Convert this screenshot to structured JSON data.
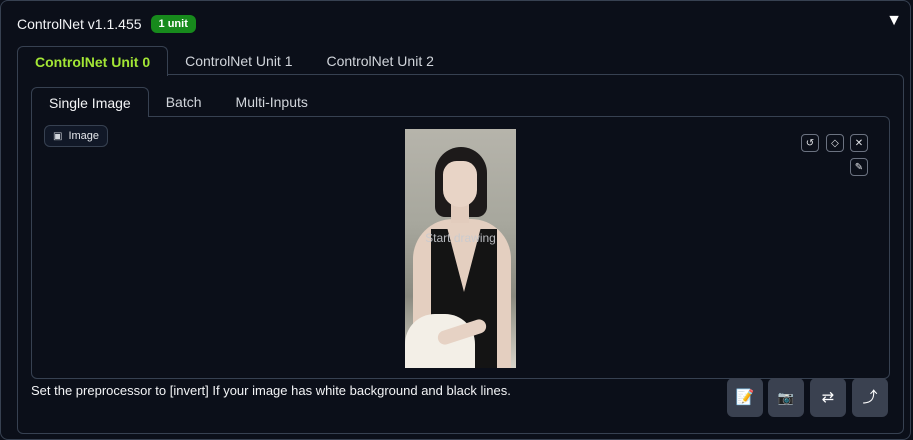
{
  "header": {
    "title": "ControlNet v1.1.455",
    "badge": "1 unit",
    "collapse_glyph": "▼"
  },
  "unit_tabs": [
    {
      "label": "ControlNet Unit 0",
      "active": true
    },
    {
      "label": "ControlNet Unit 1",
      "active": false
    },
    {
      "label": "ControlNet Unit 2",
      "active": false
    }
  ],
  "input_tabs": [
    {
      "label": "Single Image",
      "active": true
    },
    {
      "label": "Batch",
      "active": false
    },
    {
      "label": "Multi-Inputs",
      "active": false
    }
  ],
  "image_panel": {
    "label": "Image",
    "overlay_text": "Start drawing",
    "tools": [
      "undo-icon",
      "eraser-icon",
      "close-icon",
      "brush-icon"
    ]
  },
  "hint": "Set the preprocessor to [invert] If your image has white background and black lines.",
  "actions": [
    {
      "icon": "document-icon",
      "glyph": "📝"
    },
    {
      "icon": "camera-icon",
      "glyph": "📷"
    },
    {
      "icon": "swap-icon",
      "glyph": "⇄"
    },
    {
      "icon": "send-icon",
      "glyph": "⤴"
    }
  ],
  "colors": {
    "background": "#0b0f19",
    "badge": "#178a1c",
    "active_unit_tab": "#a3e635",
    "button": "#3a4150"
  }
}
